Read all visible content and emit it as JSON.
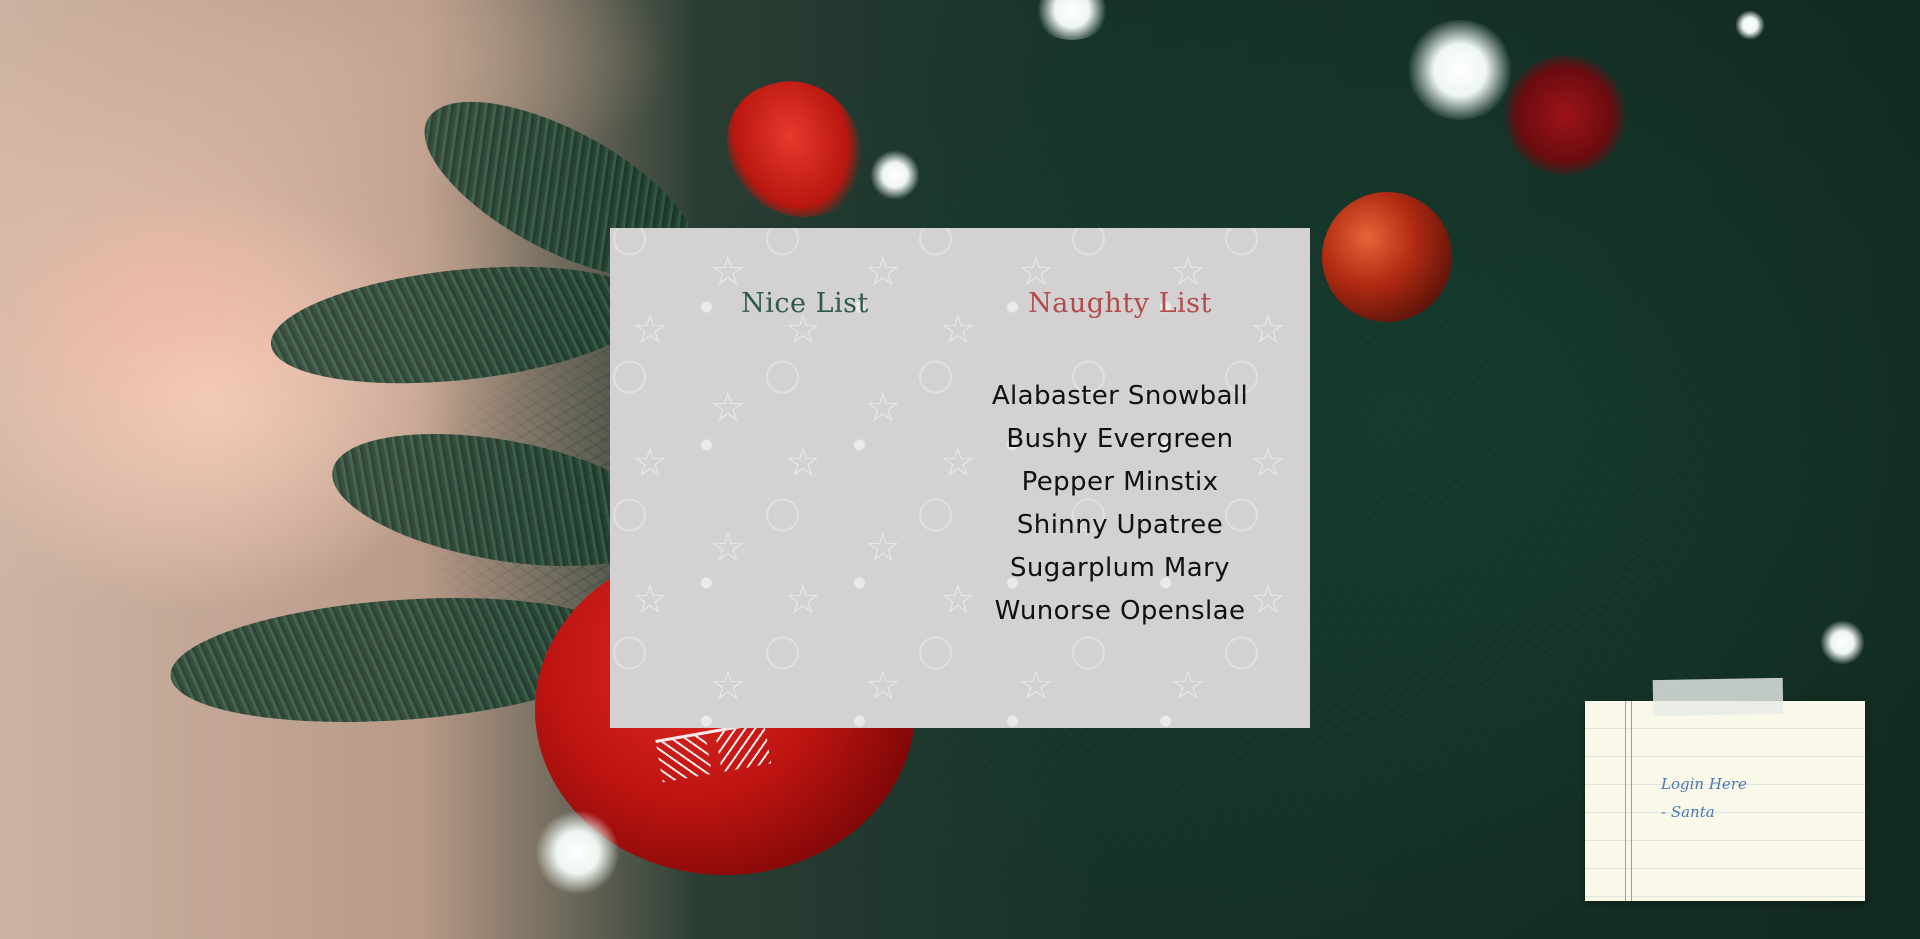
{
  "lists": {
    "nice": {
      "title": "Nice List",
      "entries": []
    },
    "naughty": {
      "title": "Naughty List",
      "entries": [
        "Alabaster Snowball",
        "Bushy Evergreen",
        "Pepper Minstix",
        "Shinny Upatree",
        "Sugarplum Mary",
        "Wunorse Openslae"
      ]
    }
  },
  "note": {
    "link_label": "Login Here",
    "signature": "- Santa"
  },
  "colors": {
    "nice_title": "#2f5a4a",
    "naughty_title": "#b24b4b",
    "panel_bg": "#d3d1d1",
    "note_paper": "#faf8e8",
    "note_link": "#4a78b4"
  }
}
